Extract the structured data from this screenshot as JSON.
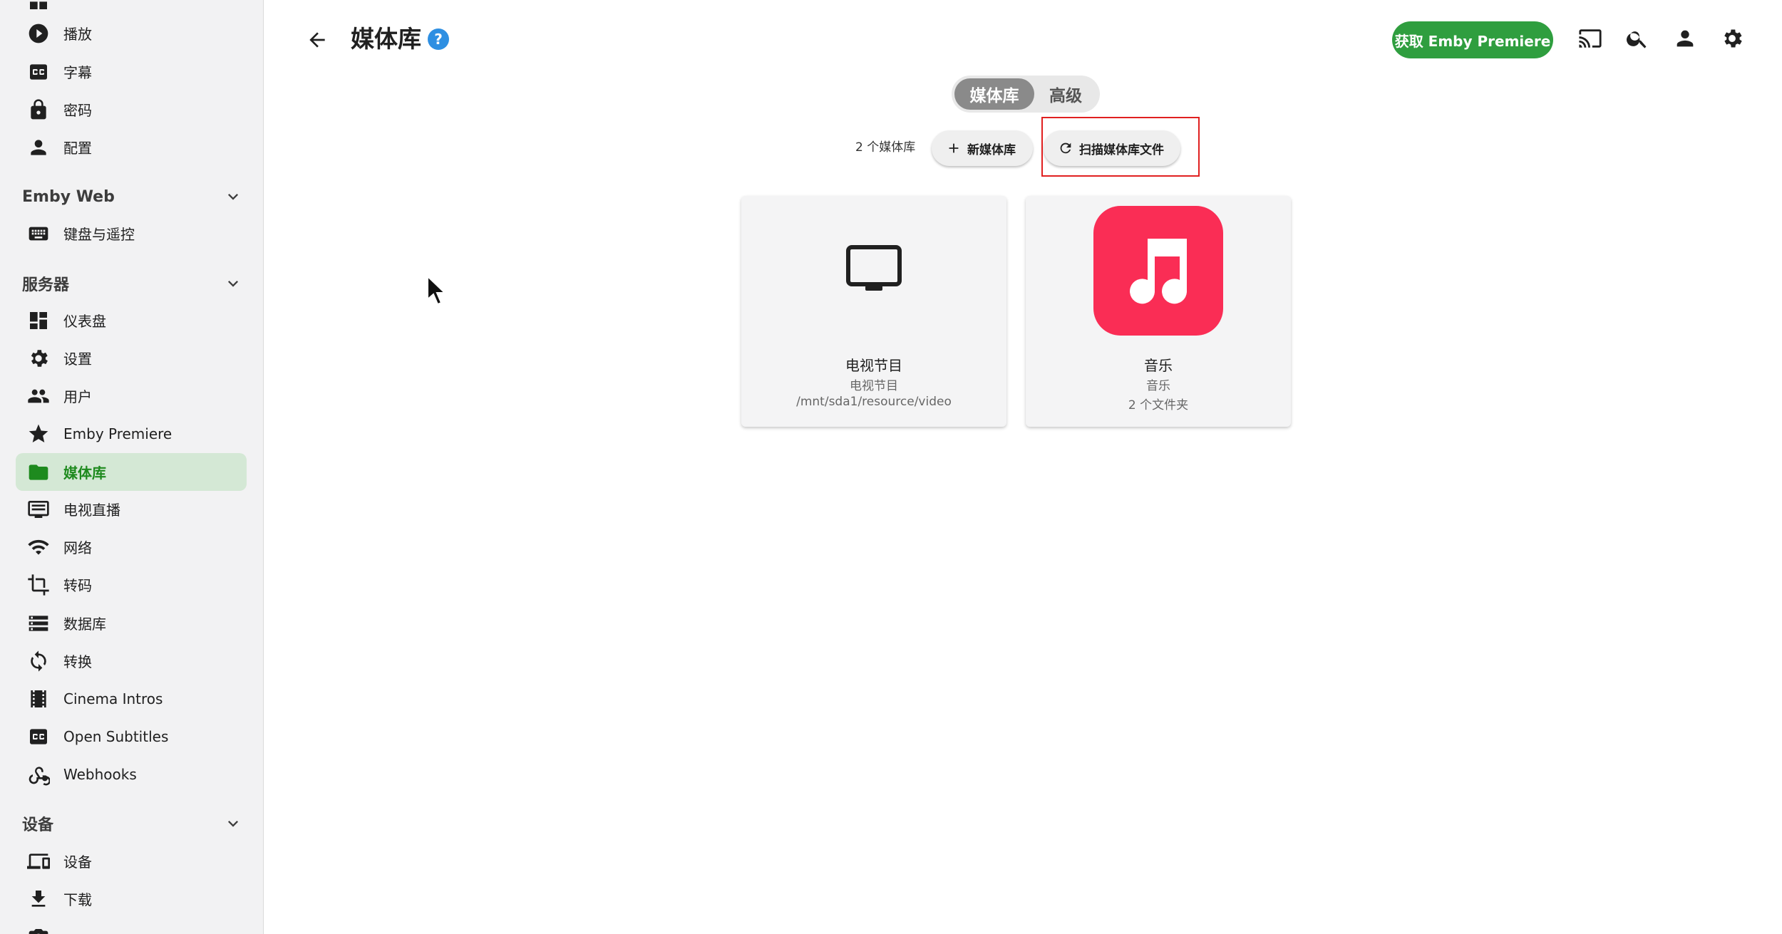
{
  "sidebar": {
    "items_top": [
      {
        "label": "播放",
        "icon": "play-circle-icon"
      },
      {
        "label": "字幕",
        "icon": "closed-caption-icon"
      },
      {
        "label": "密码",
        "icon": "lock-icon"
      },
      {
        "label": "配置",
        "icon": "person-icon"
      }
    ],
    "sections": [
      {
        "title": "Emby Web"
      },
      {
        "title": "服务器"
      },
      {
        "title": "设备"
      }
    ],
    "emby_web_items": [
      {
        "label": "键盘与遥控",
        "icon": "keyboard-icon"
      }
    ],
    "server_items": [
      {
        "label": "仪表盘",
        "icon": "dashboard-icon"
      },
      {
        "label": "设置",
        "icon": "gear-icon"
      },
      {
        "label": "用户",
        "icon": "users-icon"
      },
      {
        "label": "Emby Premiere",
        "icon": "star-icon"
      },
      {
        "label": "媒体库",
        "icon": "folder-icon",
        "active": true
      },
      {
        "label": "电视直播",
        "icon": "live-tv-icon"
      },
      {
        "label": "网络",
        "icon": "wifi-icon"
      },
      {
        "label": "转码",
        "icon": "crop-icon"
      },
      {
        "label": "数据库",
        "icon": "database-icon"
      },
      {
        "label": "转换",
        "icon": "sync-icon"
      },
      {
        "label": "Cinema Intros",
        "icon": "film-icon"
      },
      {
        "label": "Open Subtitles",
        "icon": "closed-caption-icon"
      },
      {
        "label": "Webhooks",
        "icon": "webhook-icon"
      }
    ],
    "device_items": [
      {
        "label": "设备",
        "icon": "devices-icon"
      },
      {
        "label": "下载",
        "icon": "download-icon"
      }
    ]
  },
  "header": {
    "title": "媒体库",
    "help": "?",
    "premiere_button": "获取 Emby Premiere",
    "accent": "#2f9e3f"
  },
  "tabs": [
    {
      "label": "媒体库",
      "active": true
    },
    {
      "label": "高级",
      "active": false
    }
  ],
  "toolbar": {
    "count": "2 个媒体库",
    "add_label": "新媒体库",
    "scan_label": "扫描媒体库文件"
  },
  "libraries": [
    {
      "name": "电视节目",
      "type": "电视节目",
      "detail": "/mnt/sda1/resource/video",
      "icon": "tv-icon"
    },
    {
      "name": "音乐",
      "type": "音乐",
      "detail": "2 个文件夹",
      "icon": "music-note-icon",
      "tile_color": "#fa2d55"
    }
  ],
  "colors": {
    "active_bg": "#d4e8d5",
    "active_fg": "#1e8a1e",
    "highlight": "#e02020"
  }
}
